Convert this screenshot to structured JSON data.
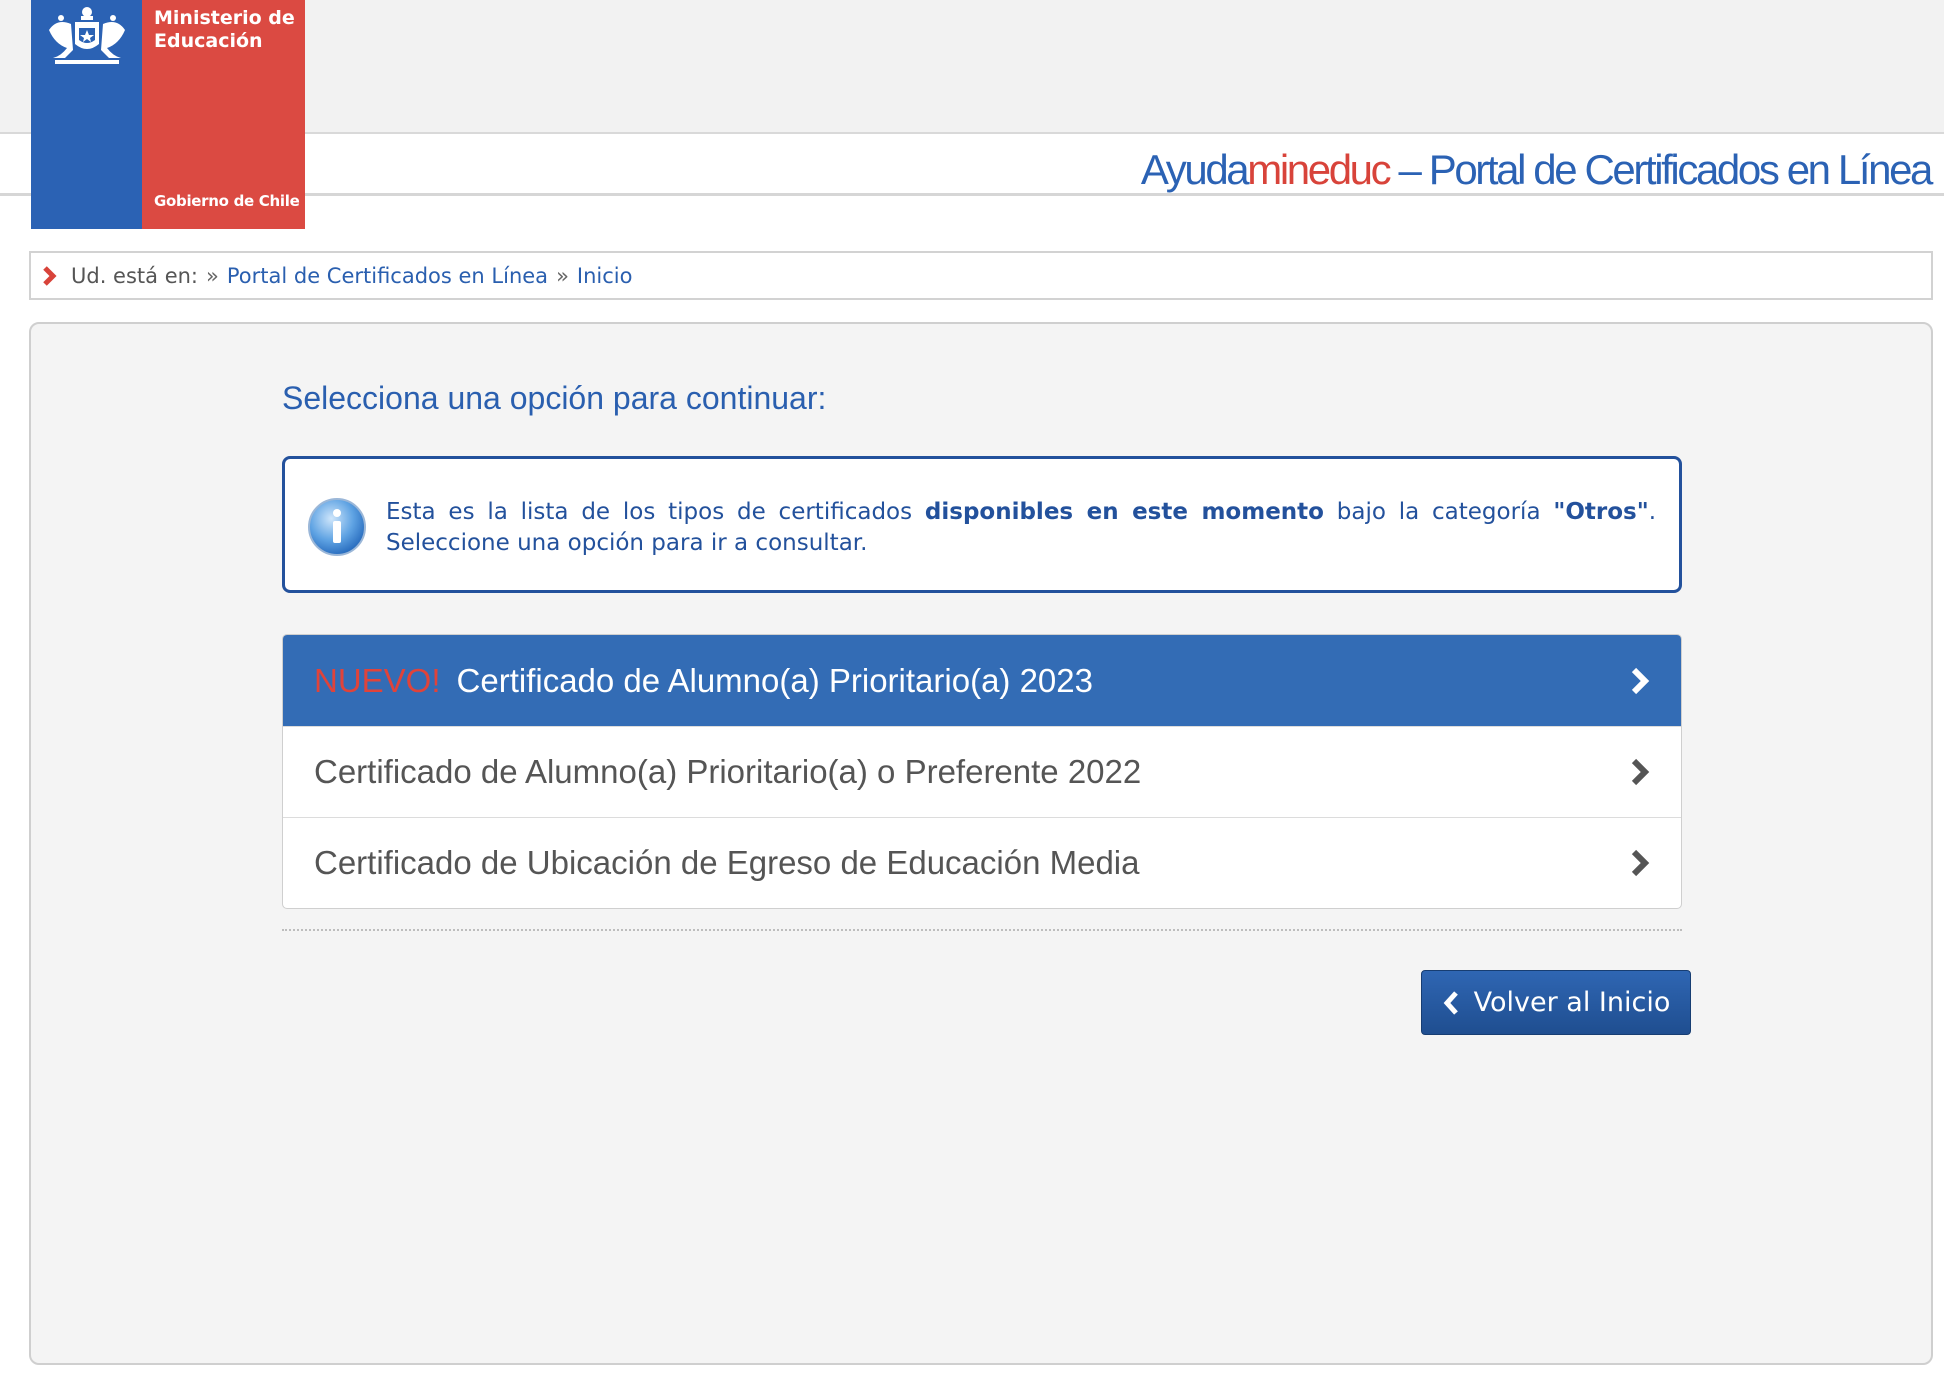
{
  "header": {
    "logo": {
      "ministry": "Ministerio de Educación",
      "government": "Gobierno de Chile",
      "crest": "chile-coat-of-arms-icon"
    },
    "site_title": {
      "part1": "Ayuda",
      "part2": "mineduc",
      "part3": " – Portal de Certificados en Línea"
    }
  },
  "breadcrumb": {
    "label": "Ud. está en:",
    "separator": "»",
    "items": [
      "Portal de Certificados en Línea",
      "Inicio"
    ]
  },
  "main": {
    "prompt": "Selecciona una opción para continuar:",
    "info": {
      "icon": "info-icon",
      "text_a": "Esta es la lista de los tipos de certificados ",
      "text_bold": "disponibles en este momento",
      "text_b": " bajo la categoría ",
      "text_quoted": "\"Otros\"",
      "text_c": ". Seleccione una opción para ir a consultar."
    },
    "options": [
      {
        "badge": "NUEVO!",
        "label": "Certificado de Alumno(a) Prioritario(a)  2023",
        "active": true
      },
      {
        "badge": "",
        "label": "Certificado de Alumno(a) Prioritario(a) o Preferente 2022",
        "active": false
      },
      {
        "badge": "",
        "label": "Certificado de Ubicación de Egreso de Educación Media",
        "active": false
      }
    ],
    "back_button": "Volver al Inicio"
  },
  "colors": {
    "brand_blue": "#2b62b4",
    "brand_red": "#db4a42",
    "active_row": "#336cb5",
    "info_border": "#23519c"
  }
}
